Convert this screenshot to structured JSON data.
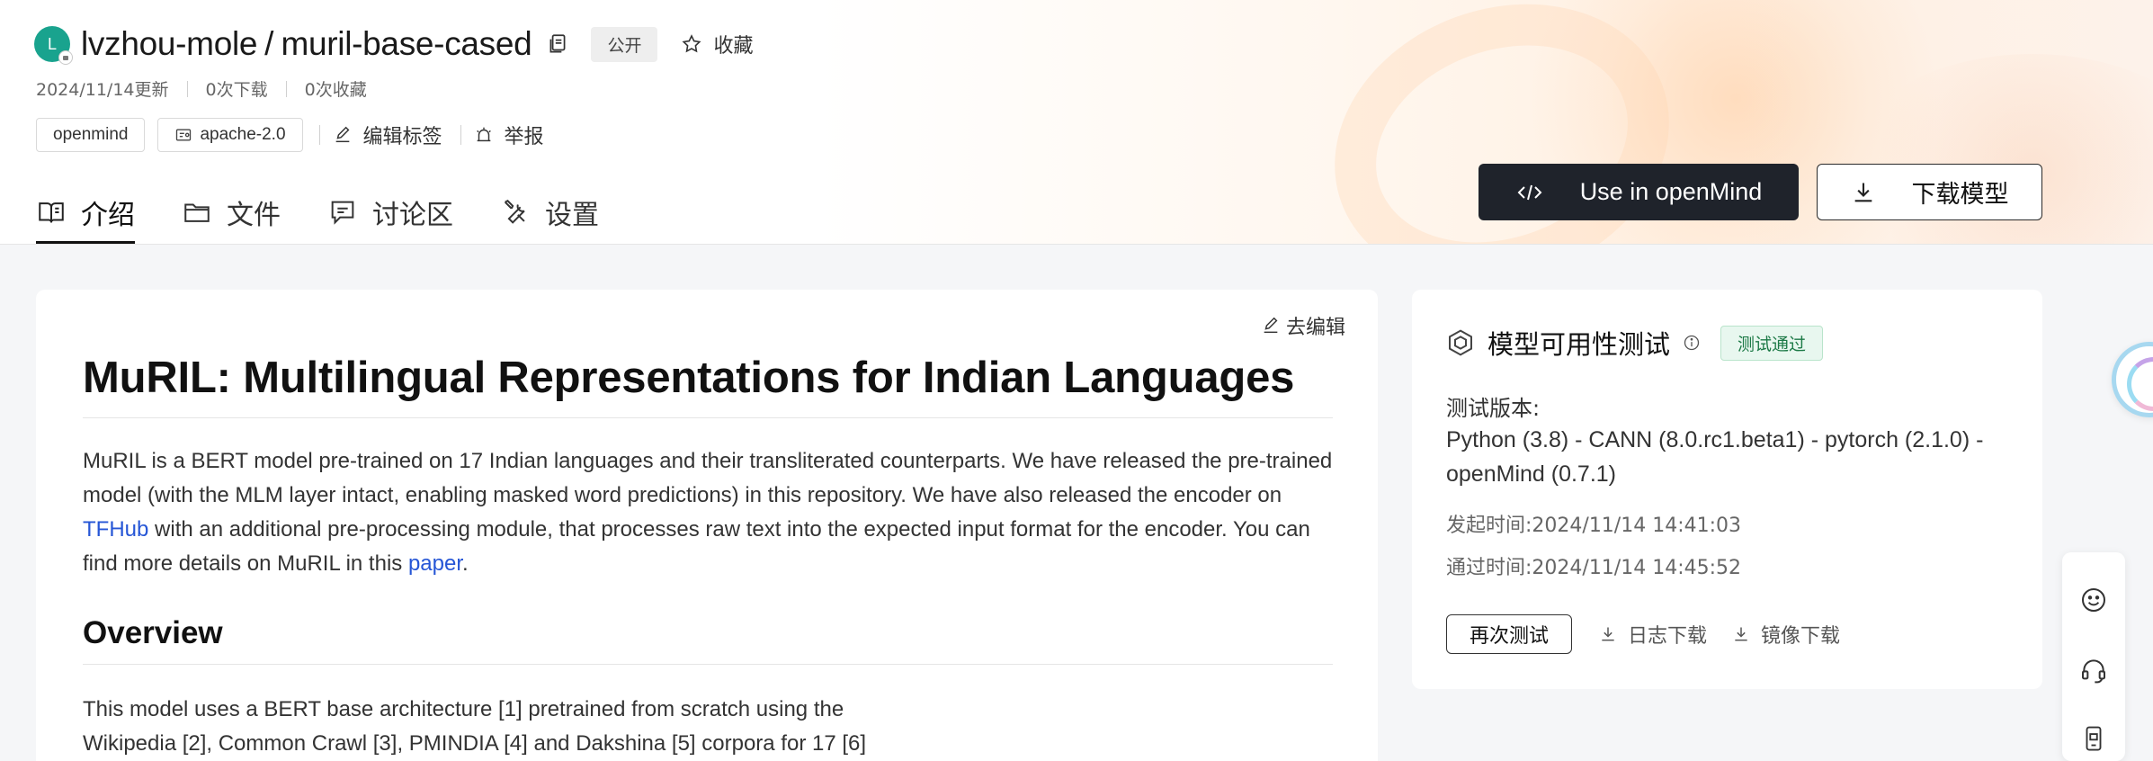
{
  "header": {
    "avatar_letter": "L",
    "owner": "lvzhou-mole",
    "separator": "/",
    "repo": "muril-base-cased",
    "visibility": "公开",
    "favorite_label": "收藏",
    "updated": "2024/11/14更新",
    "downloads": "0次下载",
    "favorites": "0次收藏",
    "tags": [
      "openmind",
      "apache-2.0"
    ],
    "edit_tags_label": "编辑标签",
    "report_label": "举报"
  },
  "tabs": [
    {
      "label": "介绍",
      "icon": "book-icon",
      "active": true
    },
    {
      "label": "文件",
      "icon": "folder-icon",
      "active": false
    },
    {
      "label": "讨论区",
      "icon": "chat-icon",
      "active": false
    },
    {
      "label": "设置",
      "icon": "tools-icon",
      "active": false
    }
  ],
  "actions": {
    "use_in_openmind": "Use in openMind",
    "download_model": "下载模型"
  },
  "readme": {
    "edit_label": "去编辑",
    "title": "MuRIL: Multilingual Representations for Indian Languages",
    "para1_a": "MuRIL is a BERT model pre-trained on 17 Indian languages and their transliterated counterparts. We have released the pre-trained model (with the MLM layer intact, enabling masked word predictions) in this repository. We have also released the encoder on ",
    "para1_link1": "TFHub",
    "para1_b": " with an additional pre-processing module, that processes raw text into the expected input format for the encoder. You can find more details on MuRIL in this ",
    "para1_link2": "paper",
    "para1_c": ".",
    "overview_heading": "Overview",
    "overview_line1": "This model uses a BERT base architecture [1] pretrained from scratch using the",
    "overview_line2": "Wikipedia [2], Common Crawl [3], PMINDIA [4] and Dakshina [5] corpora for 17 [6]"
  },
  "test_panel": {
    "title": "模型可用性测试",
    "status": "测试通过",
    "version_label": "测试版本:",
    "version_value": "Python (3.8) - CANN (8.0.rc1.beta1) - pytorch (2.1.0) - openMind (0.7.1)",
    "start_time": "发起时间:2024/11/14 14:41:03",
    "pass_time": "通过时间:2024/11/14 14:45:52",
    "retest_label": "再次测试",
    "log_download": "日志下载",
    "image_download": "镜像下载"
  },
  "colors": {
    "accent_dark": "#1f232b",
    "link": "#2656d6",
    "avatar": "#19a38e",
    "pass_badge_bg": "#e8f7ef",
    "pass_badge_text": "#1d7a47"
  }
}
